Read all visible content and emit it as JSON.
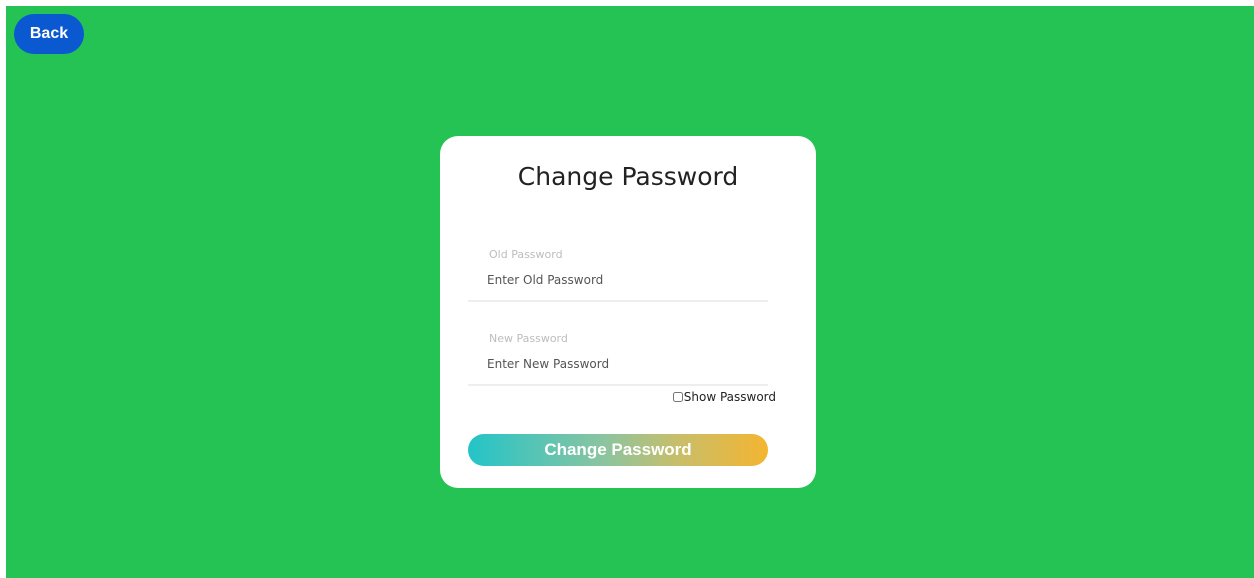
{
  "header": {
    "back_label": "Back"
  },
  "form": {
    "title": "Change Password",
    "old_password": {
      "label": "Old Password",
      "placeholder": "Enter Old Password",
      "value": ""
    },
    "new_password": {
      "label": "New Password",
      "placeholder": "Enter New Password",
      "value": ""
    },
    "show_password_label": "Show Password",
    "show_password_checked": false,
    "submit_label": "Change Password"
  },
  "colors": {
    "background": "#25c353",
    "back_button": "#0b59d1",
    "card": "#ffffff",
    "gradient_start": "#23c4c8",
    "gradient_end": "#f4b531"
  }
}
